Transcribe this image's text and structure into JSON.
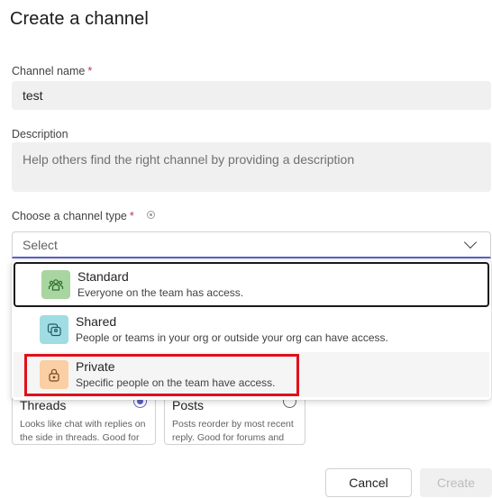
{
  "dialog": {
    "title": "Create a channel",
    "channel_name": {
      "label": "Channel name",
      "required_mark": "*",
      "value": "test"
    },
    "description": {
      "label": "Description",
      "placeholder": "Help others find the right channel by providing a description"
    },
    "channel_type": {
      "label": "Choose a channel type",
      "required_mark": "*",
      "select_placeholder": "Select"
    },
    "options": [
      {
        "name": "Standard",
        "desc": "Everyone on the team has access.",
        "icon": "people-team-icon",
        "color": "#a8d5a0"
      },
      {
        "name": "Shared",
        "desc": "People or teams in your org or outside your org can have access.",
        "icon": "shared-channel-icon",
        "color": "#9fdde3"
      },
      {
        "name": "Private",
        "desc": "Specific people on the team have access.",
        "icon": "lock-icon",
        "color": "#f9cfa3"
      }
    ],
    "layout_cards": [
      {
        "title": "Threads",
        "desc": "Looks like chat with replies on the side in threads. Good for",
        "selected": true
      },
      {
        "title": "Posts",
        "desc": "Posts reorder by most recent reply. Good for forums and",
        "selected": false
      }
    ],
    "buttons": {
      "cancel": "Cancel",
      "create": "Create"
    },
    "accent_color": "#5b5fc7",
    "highlight_color": "#e0101a"
  }
}
